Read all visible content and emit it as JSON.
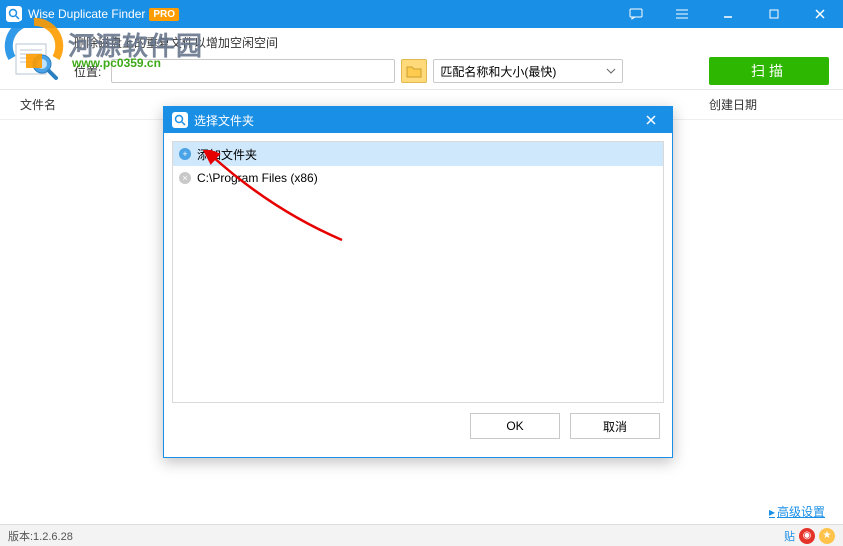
{
  "titlebar": {
    "app_name": "Wise Duplicate Finder",
    "pro_badge": "PRO"
  },
  "watermark": {
    "text": "河源软件园",
    "url": "www.pc0359.cn"
  },
  "toolbar": {
    "description": "删除磁盘上的重复文件以增加空闲空间",
    "location_label": "位置:",
    "location_value": "",
    "match_mode": "匹配名称和大小(最快)",
    "scan_label": "扫描"
  },
  "columns": {
    "name": "文件名",
    "date": "创建日期"
  },
  "dialog": {
    "title": "选择文件夹",
    "items": [
      {
        "label": "添加文件夹",
        "selected": true,
        "icon": "+"
      },
      {
        "label": "C:\\Program Files (x86)",
        "selected": false,
        "icon": "×"
      }
    ],
    "ok": "OK",
    "cancel": "取消"
  },
  "footer": {
    "advanced": "高级设置",
    "version": "版本:1.2.6.28",
    "tie": "贴"
  }
}
